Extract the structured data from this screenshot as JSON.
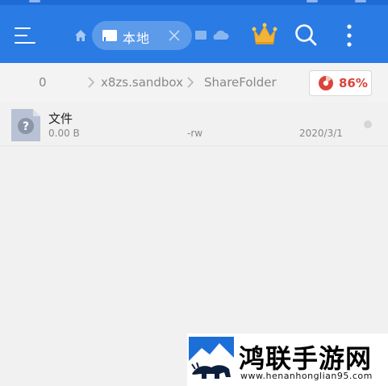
{
  "toolbar": {
    "local_tab_label": "本地",
    "icons": [
      "menu-icon",
      "home-icon",
      "book-icon",
      "close-icon",
      "cloud-icon",
      "crown-icon",
      "search-icon",
      "more-icon"
    ]
  },
  "pathbar": {
    "crumbs": [
      "0",
      "x8zs.sandbox",
      "ShareFolder"
    ],
    "storage_usage": "86%",
    "storage_usage_fraction": 0.86
  },
  "files": [
    {
      "name": "文件",
      "size": "0.00 B",
      "permissions": "-rw",
      "date": "2020/3/1"
    }
  ],
  "watermark": {
    "title": "鸿联手游网",
    "url": "www.henanhonglian95.com"
  },
  "colors": {
    "toolbar": "#2a7be4",
    "usage_accent": "#d9453a",
    "crown": "#f0b43a"
  }
}
